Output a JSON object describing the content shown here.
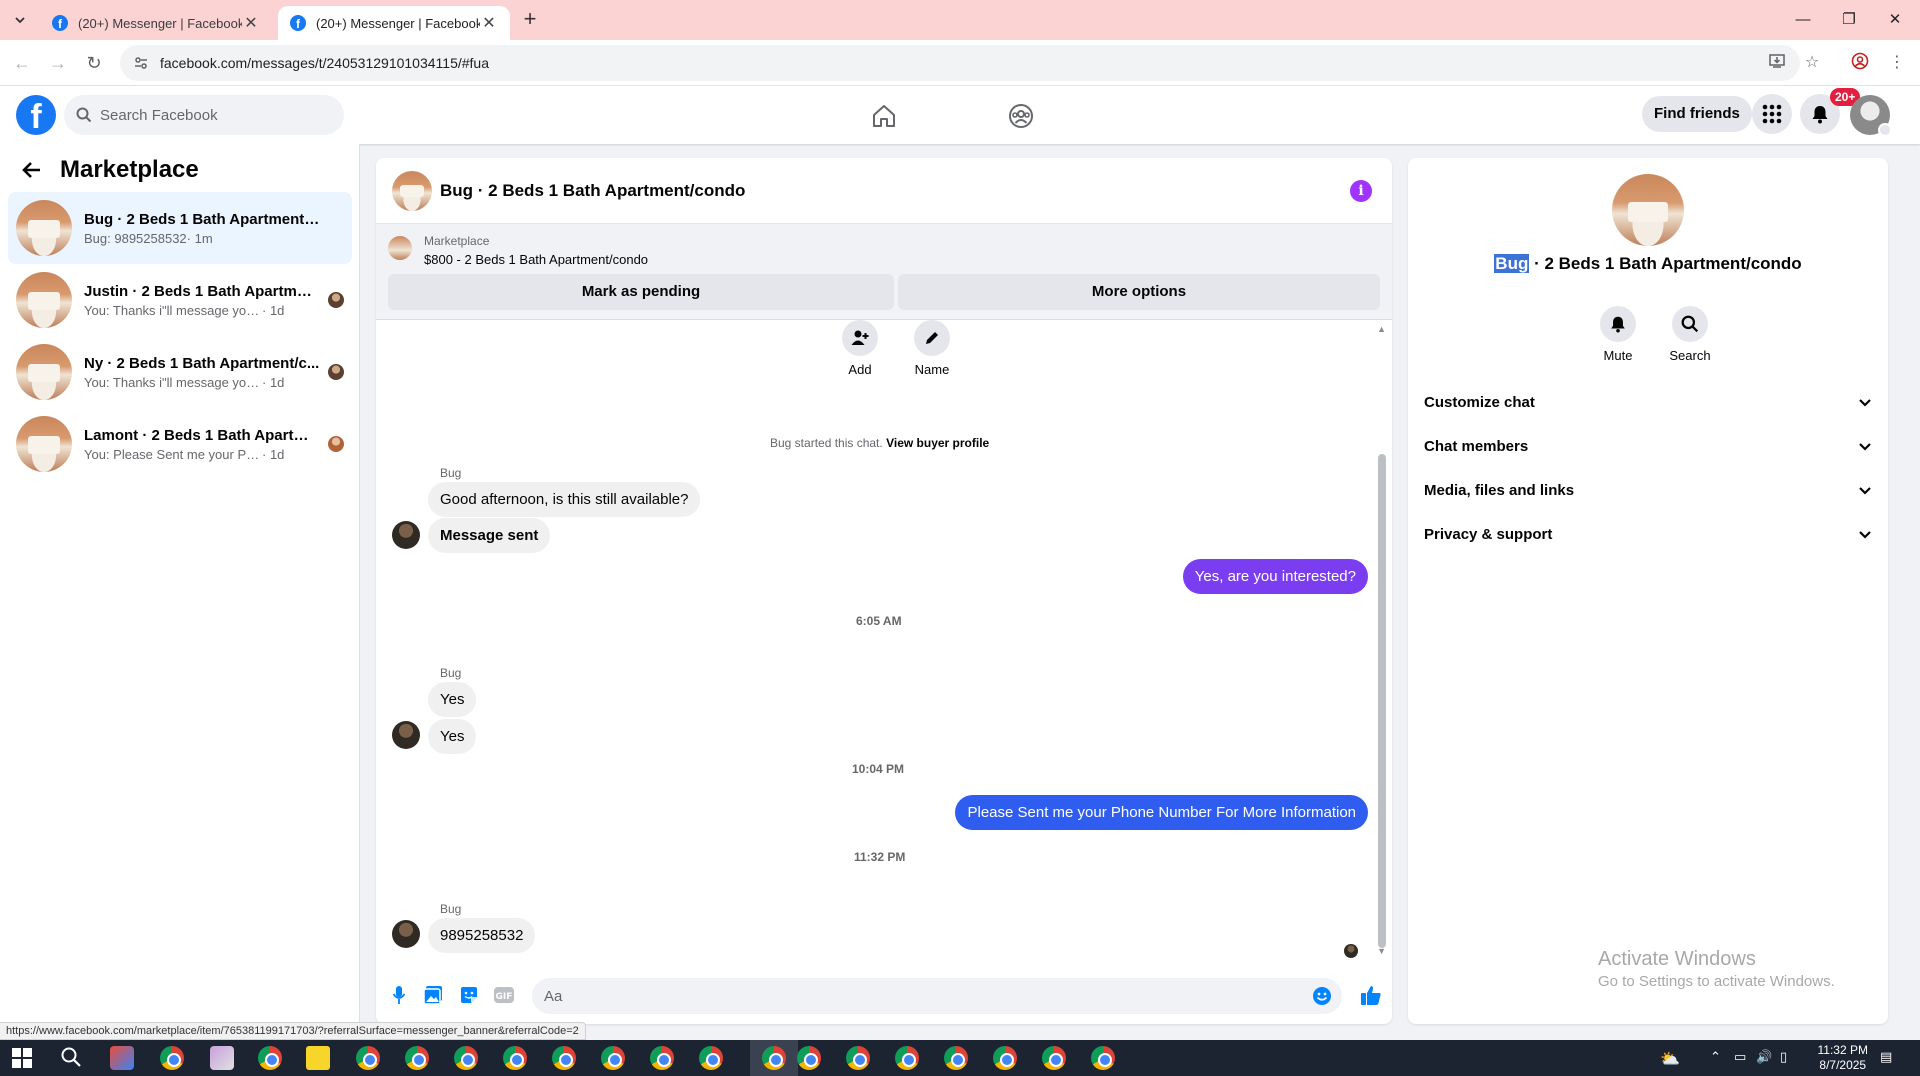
{
  "browser": {
    "tabs": [
      {
        "title": "(20+) Messenger | Facebook",
        "active": false
      },
      {
        "title": "(20+) Messenger | Facebook",
        "active": true
      }
    ],
    "url": "facebook.com/messages/t/24053129101034115/#fua"
  },
  "fb_header": {
    "search_placeholder": "Search Facebook",
    "find_friends_label": "Find friends",
    "notification_count": "20+",
    "brand_color": "#1877f2"
  },
  "left_panel": {
    "title": "Marketplace",
    "conversations": [
      {
        "name": "Bug · 2 Beds 1 Bath Apartment/co...",
        "snippet": "Bug: 9895258532",
        "time": " · 1m",
        "selected": true
      },
      {
        "name": "Justin · 2 Beds 1 Bath Apartment...",
        "snippet": "You: Thanks i\"ll message you in a ...",
        "time": " · 1d",
        "selected": false
      },
      {
        "name": "Ny · 2 Beds 1 Bath Apartment/c...",
        "snippet": "You: Thanks i\"ll message you in a ...",
        "time": " · 1d",
        "selected": false
      },
      {
        "name": "Lamont · 2 Beds 1 Bath Apartme...",
        "snippet": "You: Please Sent me your Phone N...",
        "time": " · 1d",
        "selected": false
      }
    ]
  },
  "chat": {
    "title": "Bug · 2 Beds 1 Bath Apartment/condo",
    "banner": {
      "label": "Marketplace",
      "listing": "$800 - 2 Beds 1 Bath Apartment/condo",
      "mark_pending_label": "Mark as pending",
      "more_options_label": "More options"
    },
    "actions": {
      "add_label": "Add",
      "name_label": "Name"
    },
    "started_text": "Bug started this chat.",
    "view_profile_link": "View buyer profile",
    "messages": {
      "sender1": "Bug",
      "m1": "Good afternoon, is this still available?",
      "m2": "Message sent",
      "m3": "Yes, are you interested?",
      "time1": "6:05 AM",
      "sender2": "Bug",
      "m4": "Yes",
      "m5": "Yes",
      "time2": "10:04 PM",
      "m6": "Please Sent me your Phone Number For More Information",
      "time3": "11:32 PM",
      "sender3": "Bug",
      "m7": "9895258532"
    },
    "outgoing_colors": [
      "#8a2be2",
      "#3b5cf0"
    ],
    "composer_placeholder": "Aa"
  },
  "right_panel": {
    "title_highlight": "Bug",
    "title_rest": " · 2 Beds 1 Bath Apartment/condo",
    "mute_label": "Mute",
    "search_label": "Search",
    "sections": [
      "Customize chat",
      "Chat members",
      "Media, files and links",
      "Privacy & support"
    ],
    "watermark_line1": "Activate Windows",
    "watermark_line2": "Go to Settings to activate Windows."
  },
  "status_url": "https://www.facebook.com/marketplace/item/765381199171703/?referralSurface=messenger_banner&referralCode=2",
  "taskbar": {
    "time": "11:32 PM",
    "date": "8/7/2025"
  }
}
